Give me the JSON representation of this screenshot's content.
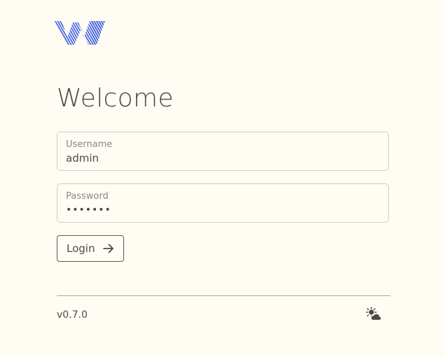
{
  "app": {
    "logo_icon": "w-logo-icon",
    "brand_color": "#3d5be0"
  },
  "login": {
    "title": "Welcome",
    "username": {
      "label": "Username",
      "value": "admin"
    },
    "password": {
      "label": "Password",
      "value": "•••••••"
    },
    "submit_label": "Login",
    "submit_icon": "arrow-right-icon"
  },
  "footer": {
    "version": "v0.7.0",
    "theme_icon": "sun-cloud-icon"
  }
}
